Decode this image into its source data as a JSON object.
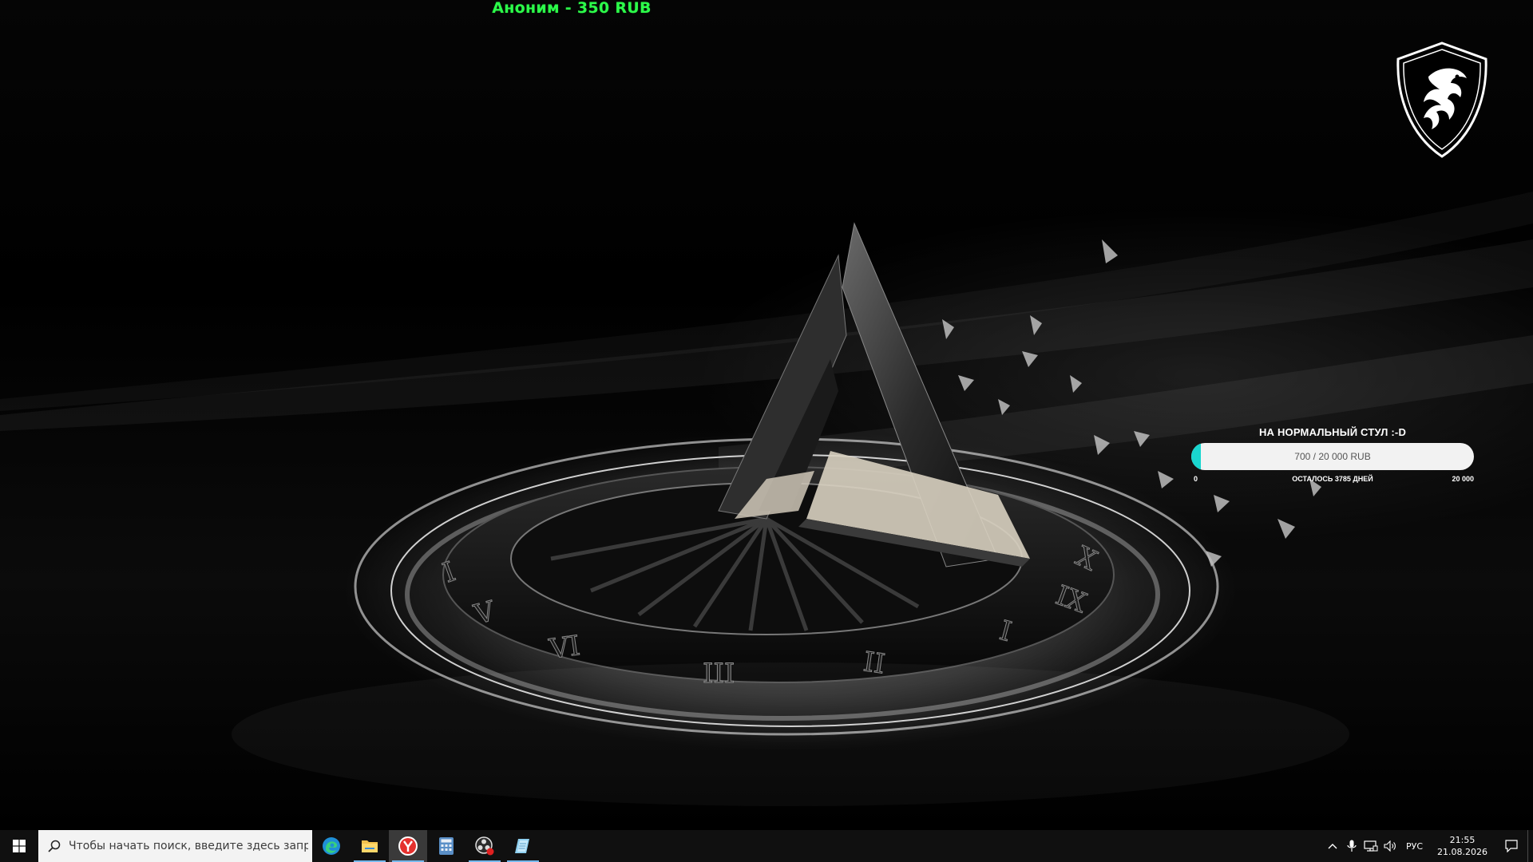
{
  "alert": {
    "text": "Аноним - 350 RUB"
  },
  "goal": {
    "title": "НА НОРМАЛЬНЫЙ СТУЛ :-D",
    "bar_text": "700 / 20 000 RUB",
    "progress": 0.035,
    "min_label": "0",
    "remaining": "ОСТАЛОСЬ 3785 ДНЕЙ",
    "max_label": "20 000",
    "bar_color": "#19d6cf"
  },
  "wallpaper": {
    "numerals": [
      "I",
      "II",
      "III",
      "VI",
      "V",
      "IX",
      "X",
      "II"
    ]
  },
  "taskbar": {
    "search_placeholder": "Чтобы начать поиск, введите здесь запрос",
    "apps": [
      {
        "icon": "edge-icon"
      },
      {
        "icon": "file-explorer-icon"
      },
      {
        "icon": "yandex-browser-icon"
      },
      {
        "icon": "calculator-icon"
      },
      {
        "icon": "obs-icon"
      },
      {
        "icon": "notepad-icon"
      }
    ],
    "tray": {
      "language": "РУС",
      "time": "21:55",
      "date": "21.08.2026"
    },
    "accent": "#76b9ed"
  }
}
